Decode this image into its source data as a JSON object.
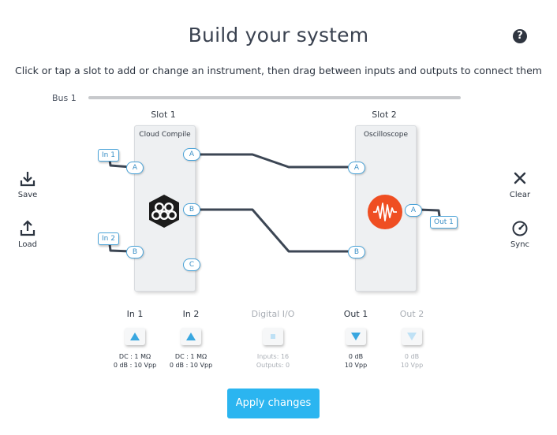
{
  "header": {
    "title": "Build your system",
    "help_icon": "question-circle-icon",
    "help_glyph": "?"
  },
  "instructions": "Click or tap a slot to add or change an instrument, then drag between inputs and outputs to connect them",
  "bus": {
    "label": "Bus 1"
  },
  "slots": [
    {
      "label": "Slot 1",
      "instrument": "Cloud Compile",
      "icon": "cloud-compile-logo-icon",
      "inputs": [
        "A",
        "B"
      ],
      "outputs": [
        "A",
        "B",
        "C"
      ]
    },
    {
      "label": "Slot 2",
      "instrument": "Oscilloscope",
      "icon": "oscilloscope-logo-icon",
      "inputs": [
        "A",
        "B"
      ],
      "outputs": [
        "A"
      ]
    }
  ],
  "external_ports": {
    "in1": "In 1",
    "in2": "In 2",
    "out1": "Out 1"
  },
  "side_actions": {
    "save": {
      "label": "Save",
      "icon": "download-icon"
    },
    "load": {
      "label": "Load",
      "icon": "upload-icon"
    },
    "clear": {
      "label": "Clear",
      "icon": "close-icon"
    },
    "sync": {
      "label": "Sync",
      "icon": "gauge-icon"
    }
  },
  "io_panel": [
    {
      "label": "In 1",
      "icon": "triangle-up-icon",
      "line1": "DC : 1 MΩ",
      "line2": "0 dB : 10 Vpp",
      "enabled": true
    },
    {
      "label": "In 2",
      "icon": "triangle-up-icon",
      "line1": "DC : 1 MΩ",
      "line2": "0 dB : 10 Vpp",
      "enabled": true
    },
    {
      "label": "Digital I/O",
      "icon": "square-icon",
      "line1": "Inputs: 16",
      "line2": "Outputs: 0",
      "enabled": false
    },
    {
      "label": "Out 1",
      "icon": "triangle-down-icon",
      "line1": "0 dB",
      "line2": "10 Vpp",
      "enabled": true
    },
    {
      "label": "Out 2",
      "icon": "triangle-down-icon",
      "line1": "0 dB",
      "line2": "10 Vpp",
      "enabled": false
    }
  ],
  "apply_button": "Apply changes",
  "colors": {
    "accent": "#2bb5f0",
    "port_blue": "#4aa3d8",
    "wire": "#3c4654",
    "scope_orange": "#ef4e22",
    "disabled": "#a9aeb5"
  }
}
